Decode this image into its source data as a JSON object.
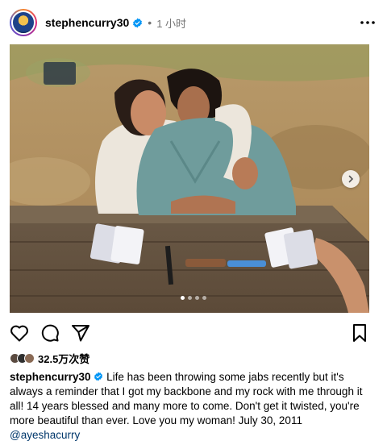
{
  "post": {
    "username": "stephencurry30",
    "separator": "•",
    "time": "1 小时",
    "likes": "32.5万次赞",
    "caption_user": "stephencurry30",
    "caption_text": "Life has been throwing some jabs recently but it's always a reminder that I got my backbone and my rock with me through it all! 14 years blessed and many more to come. Don't get it twisted, you're more beautiful than ever. Love you my woman! July 30, 2011",
    "mention": "@ayeshacurry"
  },
  "carousel": {
    "total": 4,
    "active_index": 0
  },
  "icons": {
    "verified": "verified-badge-icon",
    "more": "more-options-icon",
    "like": "heart-icon",
    "comment": "comment-bubble-icon",
    "share": "paper-plane-icon",
    "save": "bookmark-icon",
    "next": "chevron-right-icon"
  },
  "colors": {
    "verified": "#0095f6",
    "mention": "#00376b",
    "meta": "#737373"
  }
}
